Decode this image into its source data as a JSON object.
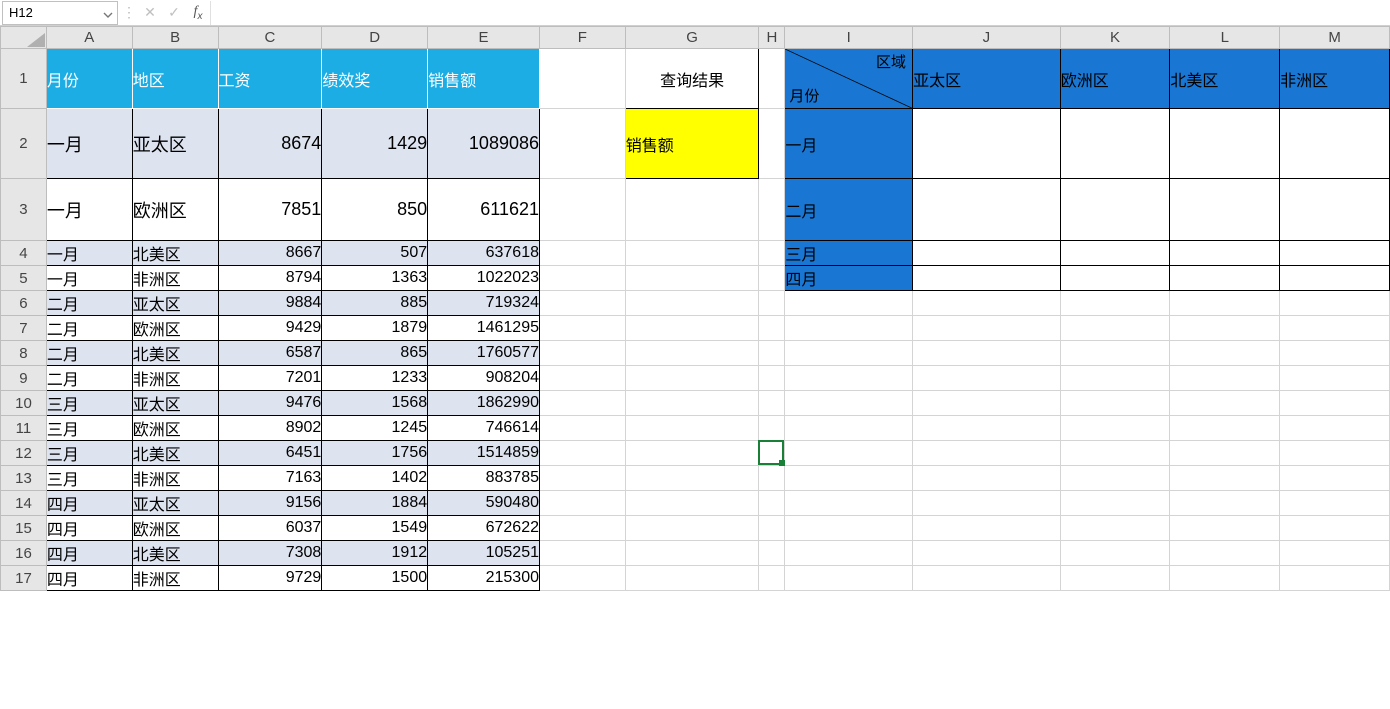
{
  "formula_bar": {
    "name_box": "H12",
    "fx_value": ""
  },
  "col_letters": [
    "A",
    "B",
    "C",
    "D",
    "E",
    "F",
    "G",
    "H",
    "I",
    "J",
    "K",
    "L",
    "M"
  ],
  "row_numbers": [
    1,
    2,
    3,
    4,
    5,
    6,
    7,
    8,
    9,
    10,
    11,
    12,
    13,
    14,
    15,
    16,
    17
  ],
  "headers": {
    "month": "月份",
    "region": "地区",
    "salary": "工资",
    "bonus": "绩效奖",
    "sales": "销售额"
  },
  "data": [
    {
      "month": "一月",
      "region": "亚太区",
      "salary": 8674,
      "bonus": 1429,
      "sales": 1089086
    },
    {
      "month": "一月",
      "region": "欧洲区",
      "salary": 7851,
      "bonus": 850,
      "sales": 611621
    },
    {
      "month": "一月",
      "region": "北美区",
      "salary": 8667,
      "bonus": 507,
      "sales": 637618
    },
    {
      "month": "一月",
      "region": "非洲区",
      "salary": 8794,
      "bonus": 1363,
      "sales": 1022023
    },
    {
      "month": "二月",
      "region": "亚太区",
      "salary": 9884,
      "bonus": 885,
      "sales": 719324
    },
    {
      "month": "二月",
      "region": "欧洲区",
      "salary": 9429,
      "bonus": 1879,
      "sales": 1461295
    },
    {
      "month": "二月",
      "region": "北美区",
      "salary": 6587,
      "bonus": 865,
      "sales": 1760577
    },
    {
      "month": "二月",
      "region": "非洲区",
      "salary": 7201,
      "bonus": 1233,
      "sales": 908204
    },
    {
      "month": "三月",
      "region": "亚太区",
      "salary": 9476,
      "bonus": 1568,
      "sales": 1862990
    },
    {
      "month": "三月",
      "region": "欧洲区",
      "salary": 8902,
      "bonus": 1245,
      "sales": 746614
    },
    {
      "month": "三月",
      "region": "北美区",
      "salary": 6451,
      "bonus": 1756,
      "sales": 1514859
    },
    {
      "month": "三月",
      "region": "非洲区",
      "salary": 7163,
      "bonus": 1402,
      "sales": 883785
    },
    {
      "month": "四月",
      "region": "亚太区",
      "salary": 9156,
      "bonus": 1884,
      "sales": 590480
    },
    {
      "month": "四月",
      "region": "欧洲区",
      "salary": 6037,
      "bonus": 1549,
      "sales": 672622
    },
    {
      "month": "四月",
      "region": "北美区",
      "salary": 7308,
      "bonus": 1912,
      "sales": 105251
    },
    {
      "month": "四月",
      "region": "非洲区",
      "salary": 9729,
      "bonus": 1500,
      "sales": 215300
    }
  ],
  "g_header": "查询结果",
  "g_yellow": "销售额",
  "pivot": {
    "top_label": "区域",
    "left_label": "月份",
    "cols": [
      "亚太区",
      "欧洲区",
      "北美区",
      "非洲区"
    ],
    "rows": [
      "一月",
      "二月",
      "三月",
      "四月"
    ]
  }
}
